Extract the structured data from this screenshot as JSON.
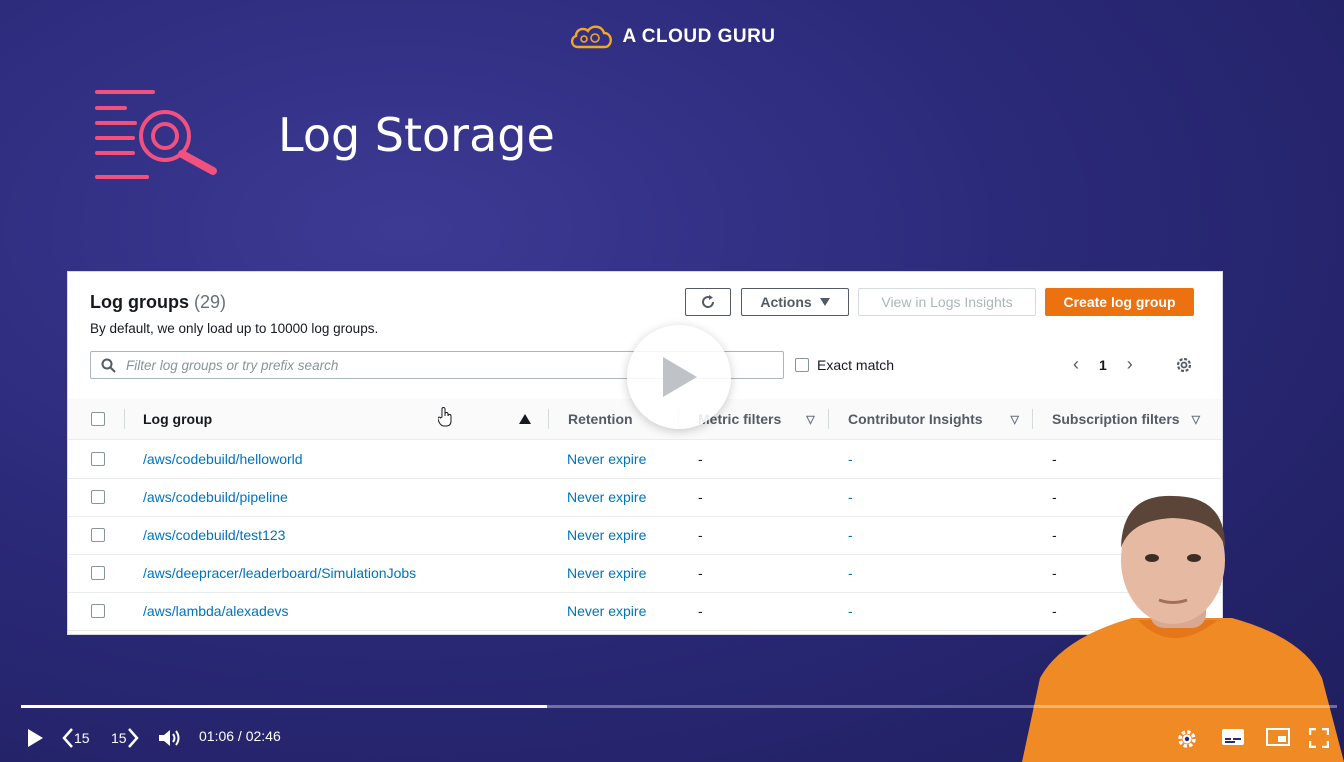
{
  "brand": {
    "name": "A CLOUD GURU"
  },
  "slide": {
    "title": "Log Storage",
    "icon": "log-search-icon"
  },
  "console": {
    "title": "Log groups",
    "count": "(29)",
    "subtitle": "By default, we only load up to 10000 log groups.",
    "buttons": {
      "actions": "Actions",
      "insights": "View in Logs Insights",
      "create": "Create log group"
    },
    "search_placeholder": "Filter log groups or try prefix search",
    "exact_match": "Exact match",
    "page": "1",
    "columns": [
      "Log group",
      "Retention",
      "Metric filters",
      "Contributor Insights",
      "Subscription filters"
    ],
    "rows": [
      {
        "name": "/aws/codebuild/helloworld",
        "retention": "Never expire",
        "metric": "-",
        "contrib": "-",
        "subs": "-"
      },
      {
        "name": "/aws/codebuild/pipeline",
        "retention": "Never expire",
        "metric": "-",
        "contrib": "-",
        "subs": "-"
      },
      {
        "name": "/aws/codebuild/test123",
        "retention": "Never expire",
        "metric": "-",
        "contrib": "-",
        "subs": "-"
      },
      {
        "name": "/aws/deepracer/leaderboard/SimulationJobs",
        "retention": "Never expire",
        "metric": "-",
        "contrib": "-",
        "subs": "-"
      },
      {
        "name": "/aws/lambda/alexadevs",
        "retention": "Never expire",
        "metric": "-",
        "contrib": "-",
        "subs": "-"
      }
    ],
    "accent": "#ec7211",
    "link_color": "#0073bb"
  },
  "player": {
    "time": "01:06 / 02:46",
    "progress": 0.4,
    "skip_back": "15",
    "skip_forward": "15"
  }
}
